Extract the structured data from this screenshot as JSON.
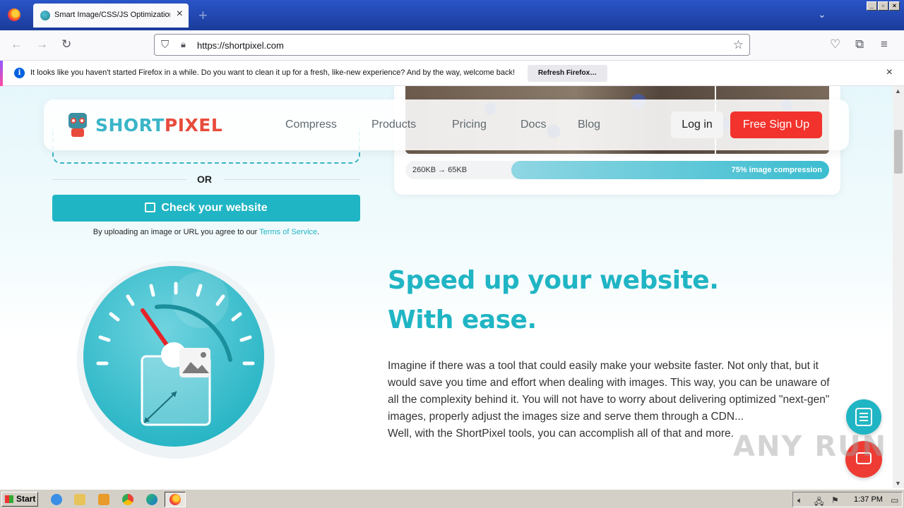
{
  "browser": {
    "tab_title": "Smart Image/CSS/JS Optimization",
    "url": "https://shortpixel.com",
    "notification_text": "It looks like you haven't started Firefox in a while. Do you want to clean it up for a fresh, like-new experience? And by the way, welcome back!",
    "notification_button": "Refresh Firefox…"
  },
  "header": {
    "logo_short": "SHORT",
    "logo_pixel": "PIXEL",
    "nav": [
      "Compress",
      "Products",
      "Pricing",
      "Docs",
      "Blog"
    ],
    "login": "Log in",
    "signup": "Free Sign Up"
  },
  "compression": {
    "sizes": "260KB → 65KB",
    "label": "75% image compression",
    "fill_fraction": 0.75
  },
  "upload": {
    "or": "OR",
    "check_button": "Check your website",
    "terms_prefix": "By uploading an image or URL you agree to our ",
    "terms_link": "Terms of Service",
    "terms_suffix": "."
  },
  "speed": {
    "title_line1": "Speed up your website.",
    "title_line2": "With ease.",
    "body": "Imagine if there was a tool that could easily make your website faster. Not only that, but it would save you time and effort when dealing with images. This way, you can be unaware of all the complexity behind it. You will not have to worry about delivering optimized \"next-gen\" images, properly adjust the images size and serve them through a CDN...",
    "body2": "Well, with the ShortPixel tools, you can accomplish all of that and more."
  },
  "watermark": "ANY RUN",
  "taskbar": {
    "start": "Start",
    "clock": "1:37 PM"
  },
  "colors": {
    "brand_teal": "#20b5c4",
    "brand_red": "#f2322c"
  }
}
